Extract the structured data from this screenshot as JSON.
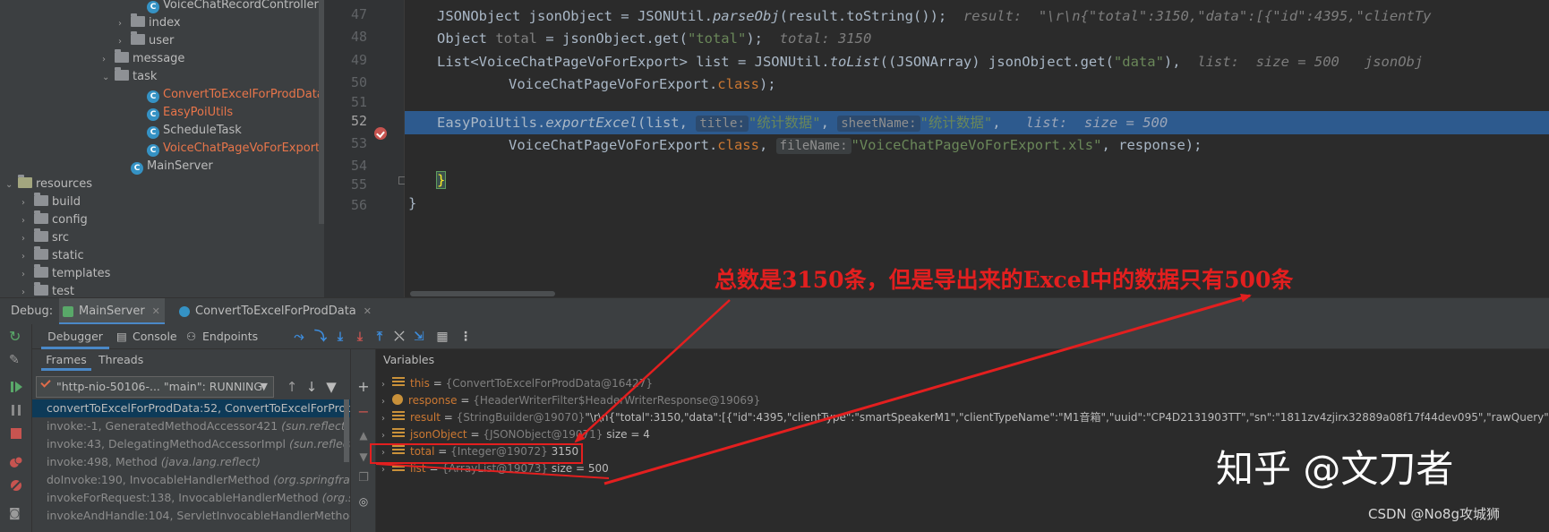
{
  "project_tree": {
    "items": [
      {
        "label": "VoiceChatRecordController",
        "depth": 9,
        "type": "class",
        "arrow": "",
        "modified": false
      },
      {
        "label": "index",
        "depth": 8,
        "type": "package",
        "arrow": "›",
        "modified": false
      },
      {
        "label": "user",
        "depth": 8,
        "type": "package",
        "arrow": "›",
        "modified": false
      },
      {
        "label": "message",
        "depth": 7,
        "type": "package",
        "arrow": "›",
        "modified": false
      },
      {
        "label": "task",
        "depth": 7,
        "type": "package",
        "arrow": "⌄",
        "modified": false
      },
      {
        "label": "ConvertToExcelForProdData",
        "depth": 9,
        "type": "class",
        "arrow": "",
        "modified": true
      },
      {
        "label": "EasyPoiUtils",
        "depth": 9,
        "type": "class",
        "arrow": "",
        "modified": true
      },
      {
        "label": "ScheduleTask",
        "depth": 9,
        "type": "class",
        "arrow": "",
        "modified": false
      },
      {
        "label": "VoiceChatPageVoForExport",
        "depth": 9,
        "type": "class",
        "arrow": "",
        "modified": true
      },
      {
        "label": "MainServer",
        "depth": 8,
        "type": "class",
        "arrow": "",
        "modified": false
      },
      {
        "label": "resources",
        "depth": 1,
        "type": "resource",
        "arrow": "⌄",
        "modified": false
      },
      {
        "label": "build",
        "depth": 2,
        "type": "folder",
        "arrow": "›",
        "modified": false
      },
      {
        "label": "config",
        "depth": 2,
        "type": "folder",
        "arrow": "›",
        "modified": false
      },
      {
        "label": "src",
        "depth": 2,
        "type": "folder",
        "arrow": "›",
        "modified": false
      },
      {
        "label": "static",
        "depth": 2,
        "type": "folder",
        "arrow": "›",
        "modified": false
      },
      {
        "label": "templates",
        "depth": 2,
        "type": "folder",
        "arrow": "›",
        "modified": false
      },
      {
        "label": "test",
        "depth": 2,
        "type": "folder",
        "arrow": "›",
        "modified": false
      }
    ]
  },
  "editor": {
    "line_numbers": [
      "47",
      "48",
      "49",
      "50",
      "51",
      "52",
      "53",
      "54",
      "55",
      "56"
    ],
    "current_line": "52",
    "lines": {
      "l47": {
        "a": "JSONObject jsonObject = JSONUtil.",
        "b": "parseObj",
        "c": "(result.toString());",
        "hint": "result:  \"\\r\\n{\"total\":3150,\"data\":[{\"id\":4395,\"clientTy"
      },
      "l48": {
        "a": "Object ",
        "b": "total",
        "c": " = jsonObject.get(",
        "s": "\"total\"",
        "d": ");",
        "hint": "total: 3150"
      },
      "l49": {
        "a": "List<VoiceChatPageVoForExport> list = JSONUtil.",
        "b": "toList",
        "c": "((JSONArray) jsonObject.get(",
        "s": "\"data\"",
        "d": "),",
        "hint": "list:  size = 500   jsonObj"
      },
      "l50": {
        "a": "VoiceChatPageVoForExport.",
        "kw": "class",
        "d": ");"
      },
      "l52": {
        "a": "EasyPoiUtils.",
        "b": "exportExcel",
        "c": "(list, ",
        "p1": "title:",
        "s1": "\"统计数据\"",
        "c2": ", ",
        "p2": "sheetName:",
        "s2": "\"统计数据\"",
        "d": ",",
        "hint": "list:  size = 500"
      },
      "l53": {
        "a": "VoiceChatPageVoForExport.",
        "kw": "class",
        "c": ", ",
        "p1": "fileName:",
        "s1": "\"VoiceChatPageVoForExport.xls\"",
        "d": ", response);"
      },
      "l54": {
        "brace": "}"
      },
      "l55": {
        "brace": "}"
      }
    }
  },
  "annotation": {
    "text": "总数是3150条，但是导出来的Excel中的数据只有500条",
    "color": "#e31f1f"
  },
  "debug": {
    "label": "Debug:",
    "tabs": [
      "MainServer",
      "ConvertToExcelForProdData"
    ],
    "toolbar_tabs": [
      "Debugger",
      "Console",
      "Endpoints"
    ],
    "frames_tabs": [
      "Frames",
      "Threads"
    ],
    "thread": "\"http-nio-50106-... \"main\": RUNNING",
    "frames": [
      {
        "name": "convertToExcelForProdData:52, ConvertToExcelForProdData",
        "pkg": ""
      },
      {
        "name": "invoke:-1, GeneratedMethodAccessor421 ",
        "pkg": "(sun.reflect)"
      },
      {
        "name": "invoke:43, DelegatingMethodAccessorImpl ",
        "pkg": "(sun.reflect)"
      },
      {
        "name": "invoke:498, Method ",
        "pkg": "(java.lang.reflect)"
      },
      {
        "name": "doInvoke:190, InvocableHandlerMethod ",
        "pkg": "(org.springframework"
      },
      {
        "name": "invokeForRequest:138, InvocableHandlerMethod ",
        "pkg": "(org.spri"
      },
      {
        "name": "invokeAndHandle:104, ServletInvocableHandlerMethod ",
        "pkg": "(or"
      }
    ],
    "variables_title": "Variables",
    "variables": [
      {
        "icon": "field",
        "name": "this",
        "ref": "{ConvertToExcelForProdData@16427}",
        "val": ""
      },
      {
        "icon": "param",
        "name": "response",
        "ref": "{HeaderWriterFilter$HeaderWriterResponse@19069}",
        "val": ""
      },
      {
        "icon": "field",
        "name": "result",
        "ref": "{StringBuilder@19070}",
        "val": "\"\\r\\n{\"total\":3150,\"data\":[{\"id\":4395,\"clientType\":\"smartSpeakerM1\",\"clientTypeName\":\"M1音箱\",\"uuid\":\"CP4D2131903TT\",\"sn\":\"1811zv4zjirx32889a08f17f44dev095\",\"rawQuery\":\"今天天气\",\"sk"
      },
      {
        "icon": "field",
        "name": "jsonObject",
        "ref": "{JSONObject@19071}",
        "val": " size = 4"
      },
      {
        "icon": "field",
        "name": "total",
        "ref": "{Integer@19072}",
        "val": " 3150"
      },
      {
        "icon": "field",
        "name": "list",
        "ref": "{ArrayList@19073}",
        "val": " size = 500"
      }
    ]
  },
  "watermarks": {
    "zhihu": "知乎 @文刀者",
    "csdn": "CSDN @No8g攻城狮"
  }
}
